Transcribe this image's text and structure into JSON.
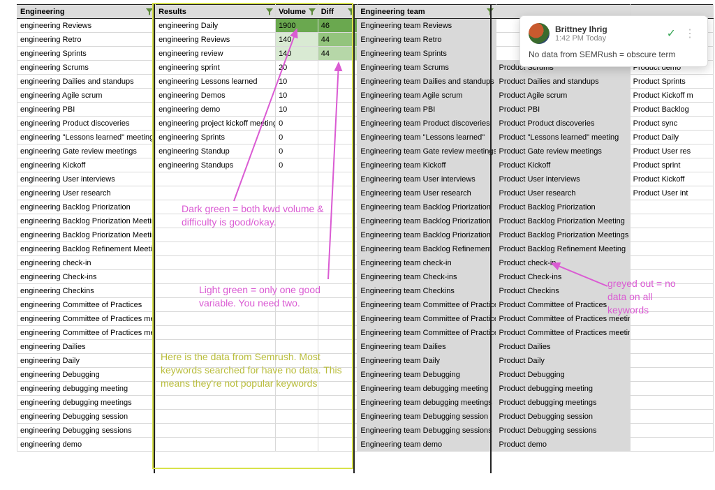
{
  "headers": {
    "col_eng": "Engineering",
    "col_res": "Results",
    "col_vol": "Volume",
    "col_diff": "Diff",
    "col_team": "Engineering team",
    "col_p1": "",
    "col_p2": ""
  },
  "rows": [
    {
      "eng": "engineering Reviews",
      "res": "engineering Daily",
      "vol": "1900",
      "diff": "46",
      "volCls": "dark-green",
      "diffCls": "dark-green",
      "team": "Engineering team Reviews",
      "teamGrey": true,
      "p1": "",
      "p2": ""
    },
    {
      "eng": "engineering Retro",
      "res": "engineering Reviews",
      "vol": "140",
      "diff": "44",
      "volCls": "faint-green",
      "diffCls": "mid-green",
      "team": "Engineering team Retro",
      "teamGrey": true,
      "p1": "",
      "p2": ""
    },
    {
      "eng": "engineering Sprints",
      "res": "engineering review",
      "vol": "140",
      "diff": "44",
      "volCls": "faint-green",
      "diffCls": "light-green",
      "team": "Engineering team Sprints",
      "teamGrey": true,
      "p1": "",
      "p2": ""
    },
    {
      "eng": "engineering Scrums",
      "res": "engineering sprint",
      "vol": "20",
      "diff": "",
      "volCls": "",
      "diffCls": "",
      "team": "Engineering team Scrums",
      "teamGrey": true,
      "p1": "Product Scrums",
      "p1Grey": true,
      "p2": "Product demo"
    },
    {
      "eng": "engineering Dailies and standups",
      "res": "engineering Lessons learned",
      "vol": "10",
      "diff": "",
      "volCls": "",
      "diffCls": "",
      "team": "Engineering team Dailies and standups",
      "teamGrey": true,
      "p1": "Product Dailies and standups",
      "p1Grey": true,
      "p2": "Product Sprints"
    },
    {
      "eng": "engineering Agile scrum",
      "res": "engineering Demos",
      "vol": "10",
      "diff": "",
      "volCls": "",
      "diffCls": "",
      "team": "Engineering team Agile scrum",
      "teamGrey": true,
      "p1": "Product Agile scrum",
      "p1Grey": true,
      "p2": "Product Kickoff m"
    },
    {
      "eng": "engineering PBI",
      "res": "engineering demo",
      "vol": "10",
      "diff": "",
      "volCls": "",
      "diffCls": "",
      "team": "Engineering team PBI",
      "teamGrey": true,
      "p1": "Product PBI",
      "p1Grey": true,
      "p2": "Product Backlog"
    },
    {
      "eng": "engineering Product discoveries",
      "res": "engineering project kickoff meetings",
      "vol": "0",
      "diff": "",
      "volCls": "",
      "diffCls": "",
      "team": "Engineering team Product discoveries",
      "teamGrey": true,
      "p1": "Product Product discoveries",
      "p1Grey": true,
      "p2": "Product sync"
    },
    {
      "eng": "engineering \"Lessons learned\" meeting",
      "res": "engineering Sprints",
      "vol": "0",
      "diff": "",
      "volCls": "",
      "diffCls": "",
      "team": "Engineering team \"Lessons learned\"",
      "teamGrey": true,
      "p1": "Product \"Lessons learned\" meeting",
      "p1Grey": true,
      "p2": "Product Daily"
    },
    {
      "eng": "engineering Gate review meetings",
      "res": "engineering Standup",
      "vol": "0",
      "diff": "",
      "volCls": "",
      "diffCls": "",
      "team": "Engineering team Gate review meetings",
      "teamGrey": true,
      "p1": "Product Gate review meetings",
      "p1Grey": true,
      "p2": "Product User res"
    },
    {
      "eng": "engineering Kickoff",
      "res": "engineering Standups",
      "vol": "0",
      "diff": "",
      "volCls": "",
      "diffCls": "",
      "team": "Engineering team Kickoff",
      "teamGrey": true,
      "p1": "Product Kickoff",
      "p1Grey": true,
      "p2": "Product sprint"
    },
    {
      "eng": "engineering User interviews",
      "res": "",
      "vol": "",
      "diff": "",
      "volCls": "",
      "diffCls": "",
      "team": "Engineering team User interviews",
      "teamGrey": true,
      "p1": "Product User interviews",
      "p1Grey": true,
      "p2": "Product Kickoff"
    },
    {
      "eng": "engineering User research",
      "res": "",
      "vol": "",
      "diff": "",
      "volCls": "",
      "diffCls": "",
      "team": "Engineering team User research",
      "teamGrey": true,
      "p1": "Product User research",
      "p1Grey": true,
      "p2": "Product User int"
    },
    {
      "eng": "engineering Backlog Priorization",
      "res": "",
      "vol": "",
      "diff": "",
      "volCls": "",
      "diffCls": "",
      "team": "Engineering team Backlog Priorization",
      "teamGrey": true,
      "p1": "Product Backlog Priorization",
      "p1Grey": true,
      "p2": ""
    },
    {
      "eng": "engineering Backlog Priorization Meeting",
      "res": "",
      "vol": "",
      "diff": "",
      "volCls": "",
      "diffCls": "",
      "team": "Engineering team Backlog Priorization",
      "teamGrey": true,
      "p1": "Product Backlog Priorization Meeting",
      "p1Grey": true,
      "p2": ""
    },
    {
      "eng": "engineering Backlog Priorization Meetings",
      "res": "",
      "vol": "",
      "diff": "",
      "volCls": "",
      "diffCls": "",
      "team": "Engineering team Backlog Priorization",
      "teamGrey": true,
      "p1": "Product Backlog Priorization Meetings",
      "p1Grey": true,
      "p2": ""
    },
    {
      "eng": "engineering Backlog Refinement Meeting",
      "res": "",
      "vol": "",
      "diff": "",
      "volCls": "",
      "diffCls": "",
      "team": "Engineering team Backlog Refinement",
      "teamGrey": true,
      "p1": "Product Backlog Refinement Meeting",
      "p1Grey": true,
      "p2": ""
    },
    {
      "eng": "engineering check-in",
      "res": "",
      "vol": "",
      "diff": "",
      "volCls": "",
      "diffCls": "",
      "team": "Engineering team check-in",
      "teamGrey": true,
      "p1": "Product check-in",
      "p1Grey": true,
      "p2": ""
    },
    {
      "eng": "engineering Check-ins",
      "res": "",
      "vol": "",
      "diff": "",
      "volCls": "",
      "diffCls": "",
      "team": "Engineering team Check-ins",
      "teamGrey": true,
      "p1": "Product Check-ins",
      "p1Grey": true,
      "p2": ""
    },
    {
      "eng": "engineering Checkins",
      "res": "",
      "vol": "",
      "diff": "",
      "volCls": "",
      "diffCls": "",
      "team": "Engineering team Checkins",
      "teamGrey": true,
      "p1": "Product Checkins",
      "p1Grey": true,
      "p2": ""
    },
    {
      "eng": "engineering Committee of Practices",
      "res": "",
      "vol": "",
      "diff": "",
      "volCls": "",
      "diffCls": "",
      "team": "Engineering team Committee of Practices",
      "teamGrey": true,
      "p1": "Product Committee of Practices",
      "p1Grey": true,
      "p2": ""
    },
    {
      "eng": "engineering Committee of Practices meeting",
      "res": "",
      "vol": "",
      "diff": "",
      "volCls": "",
      "diffCls": "",
      "team": "Engineering team Committee of Practices",
      "teamGrey": true,
      "p1": "Product Committee of Practices meeting",
      "p1Grey": true,
      "p2": ""
    },
    {
      "eng": "engineering Committee of Practices meetings",
      "res": "",
      "vol": "",
      "diff": "",
      "volCls": "",
      "diffCls": "",
      "team": "Engineering team Committee of Practices",
      "teamGrey": true,
      "p1": "Product Committee of Practices meetings",
      "p1Grey": true,
      "p2": ""
    },
    {
      "eng": "engineering Dailies",
      "res": "",
      "vol": "",
      "diff": "",
      "volCls": "",
      "diffCls": "",
      "team": "Engineering team Dailies",
      "teamGrey": true,
      "p1": "Product Dailies",
      "p1Grey": true,
      "p2": ""
    },
    {
      "eng": "engineering Daily",
      "res": "",
      "vol": "",
      "diff": "",
      "volCls": "",
      "diffCls": "",
      "team": "Engineering team Daily",
      "teamGrey": true,
      "p1": "Product Daily",
      "p1Grey": true,
      "p2": ""
    },
    {
      "eng": "engineering Debugging",
      "res": "",
      "vol": "",
      "diff": "",
      "volCls": "",
      "diffCls": "",
      "team": "Engineering team Debugging",
      "teamGrey": true,
      "p1": "Product Debugging",
      "p1Grey": true,
      "p2": ""
    },
    {
      "eng": "engineering debugging meeting",
      "res": "",
      "vol": "",
      "diff": "",
      "volCls": "",
      "diffCls": "",
      "team": "Engineering team debugging meeting",
      "teamGrey": true,
      "p1": "Product debugging meeting",
      "p1Grey": true,
      "p2": ""
    },
    {
      "eng": "engineering debugging meetings",
      "res": "",
      "vol": "",
      "diff": "",
      "volCls": "",
      "diffCls": "",
      "team": "Engineering team debugging meetings",
      "teamGrey": true,
      "p1": "Product debugging meetings",
      "p1Grey": true,
      "p2": ""
    },
    {
      "eng": "engineering Debugging session",
      "res": "",
      "vol": "",
      "diff": "",
      "volCls": "",
      "diffCls": "",
      "team": "Engineering team Debugging session",
      "teamGrey": true,
      "p1": "Product Debugging session",
      "p1Grey": true,
      "p2": ""
    },
    {
      "eng": "engineering Debugging sessions",
      "res": "",
      "vol": "",
      "diff": "",
      "volCls": "",
      "diffCls": "",
      "team": "Engineering team Debugging sessions",
      "teamGrey": true,
      "p1": "Product Debugging sessions",
      "p1Grey": true,
      "p2": ""
    },
    {
      "eng": "engineering demo",
      "res": "",
      "vol": "",
      "diff": "",
      "volCls": "",
      "diffCls": "",
      "team": "Engineering team demo",
      "teamGrey": true,
      "p1": "Product demo",
      "p1Grey": true,
      "p2": ""
    }
  ],
  "annotations": {
    "dark_green": "Dark green = both kwd volume & difficulty is good/okay.",
    "light_green": "Light green = only one good variable. You need two.",
    "greyed": "greyed out = no data on all keywords",
    "semrush": "Here is the data from Semrush. Most keywords searched for have no data. This means they're not popular keywords"
  },
  "comment": {
    "author": "Brittney Ihrig",
    "time": "1:42 PM Today",
    "text": "No data from SEMRush = obscure term"
  },
  "colors": {
    "annotation_pink": "#da5bd3",
    "annotation_yellow": "#b9bd3c",
    "dark_green": "#6aa84f",
    "mid_green": "#93c47d",
    "light_green": "#b6d7a8",
    "faint_green": "#d9ead3",
    "grey_fill": "#d9d9d9"
  }
}
